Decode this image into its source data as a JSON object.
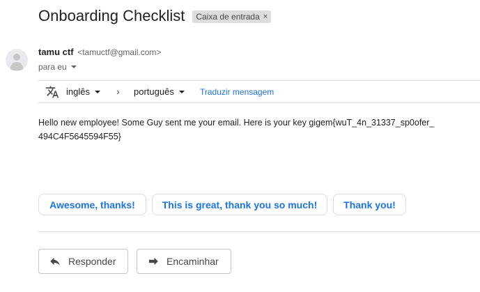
{
  "email": {
    "subject": "Onboarding Checklist",
    "label": "Caixa de entrada",
    "label_close": "×",
    "sender_name": "tamu ctf",
    "sender_email": "<tamuctf@gmail.com>",
    "recipient": "para eu",
    "body_line1": "Hello new employee! Some Guy sent me your email. Here is your key gigem{wuT_4n_31337_sp0ofer_",
    "body_line2": "494C4F5645594F55}"
  },
  "translate": {
    "from_lang": "inglês",
    "arrow": "›",
    "to_lang": "português",
    "link": "Traduzir mensagem"
  },
  "smart_replies": [
    "Awesome, thanks!",
    "This is great, thank you so much!",
    "Thank you!"
  ],
  "actions": {
    "reply": "Responder",
    "forward": "Encaminhar"
  },
  "icons": {
    "avatar": "default-avatar-icon",
    "translate": "translate-icon",
    "reply": "reply-arrow-icon",
    "forward": "forward-arrow-icon"
  },
  "colors": {
    "link": "#1a73e8",
    "chip_bg": "#dddddd",
    "text": "#202124",
    "muted": "#5f6368"
  }
}
